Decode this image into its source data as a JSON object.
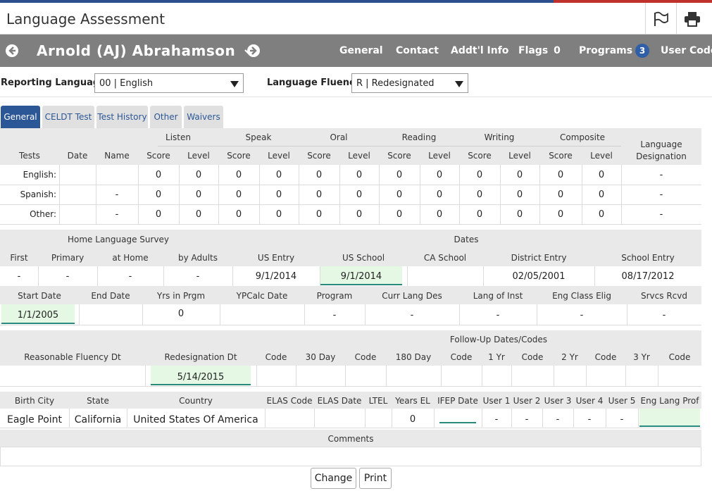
{
  "app": {
    "title": "Language Assessment"
  },
  "header": {
    "student_name": "Arnold (AJ) Abrahamson",
    "nav": [
      "General",
      "Contact",
      "Addt'l Info",
      "Flags",
      "Programs",
      "User Code"
    ],
    "flags_count": "0",
    "programs_count": "3"
  },
  "filters": {
    "reporting_language_label": "Reporting Language:",
    "reporting_language_value": "00 | English",
    "language_fluency_label": "Language Fluency:",
    "language_fluency_value": "R | Redesignated"
  },
  "tabs": [
    "General",
    "CELDT Test",
    "Test History",
    "Other",
    "Waivers"
  ],
  "tests": {
    "groups": [
      "Listen",
      "Speak",
      "Oral",
      "Reading",
      "Writing",
      "Composite"
    ],
    "col_tests": "Tests",
    "col_date": "Date",
    "col_name": "Name",
    "score": "Score",
    "level": "Level",
    "designation": "Language Designation",
    "rows": [
      {
        "label": "English:",
        "date": "",
        "name": "",
        "values": [
          "0",
          "0",
          "0",
          "0",
          "0",
          "0",
          "0",
          "0",
          "0",
          "0",
          "0",
          "0"
        ],
        "designation": "-"
      },
      {
        "label": "Spanish:",
        "date": "",
        "name": "-",
        "values": [
          "0",
          "0",
          "0",
          "0",
          "0",
          "0",
          "0",
          "0",
          "0",
          "0",
          "0",
          "0"
        ],
        "designation": "-"
      },
      {
        "label": "Other:",
        "date": "",
        "name": "-",
        "values": [
          "0",
          "0",
          "0",
          "0",
          "0",
          "0",
          "0",
          "0",
          "0",
          "0",
          "0",
          "0"
        ],
        "designation": "-"
      }
    ]
  },
  "survey": {
    "group_home": "Home Language Survey",
    "group_dates": "Dates",
    "headers": [
      "First",
      "Primary",
      "at Home",
      "by Adults",
      "US Entry",
      "US School",
      "CA School",
      "District Entry",
      "School Entry"
    ],
    "values": [
      "-",
      "-",
      "-",
      "-",
      "9/1/2014",
      "9/1/2014",
      "",
      "02/05/2001",
      "08/17/2012"
    ]
  },
  "program": {
    "headers": [
      "Start Date",
      "End Date",
      "Yrs in Prgm",
      "YPCalc Date",
      "Program",
      "Curr Lang Des",
      "Lang of Inst",
      "Eng Class Elig",
      "Srvcs Rcvd"
    ],
    "values": [
      "1/1/2005",
      "",
      "0",
      "",
      "-",
      "-",
      "-",
      "-",
      "-"
    ]
  },
  "followup": {
    "group": "Follow-Up Dates/Codes",
    "headers": [
      "Reasonable Fluency Dt",
      "Redesignation Dt",
      "Code",
      "30 Day",
      "Code",
      "180 Day",
      "Code",
      "1 Yr",
      "Code",
      "2 Yr",
      "Code",
      "3 Yr",
      "Code"
    ],
    "values": [
      "",
      "5/14/2015",
      "",
      "",
      "",
      "",
      "",
      "",
      "",
      "",
      "",
      "",
      ""
    ]
  },
  "birth": {
    "headers": [
      "Birth City",
      "State",
      "Country",
      "ELAS Code",
      "ELAS Date",
      "LTEL",
      "Years EL",
      "IFEP Date",
      "User 1",
      "User 2",
      "User 3",
      "User 4",
      "User 5",
      "Eng Lang Prof"
    ],
    "values": [
      "Eagle Point",
      "California",
      "United States Of America",
      "",
      "",
      "",
      "0",
      "",
      "-",
      "-",
      "-",
      "-",
      "-",
      ""
    ]
  },
  "comments": {
    "label": "Comments",
    "value": ""
  },
  "buttons": {
    "change": "Change",
    "print": "Print"
  }
}
